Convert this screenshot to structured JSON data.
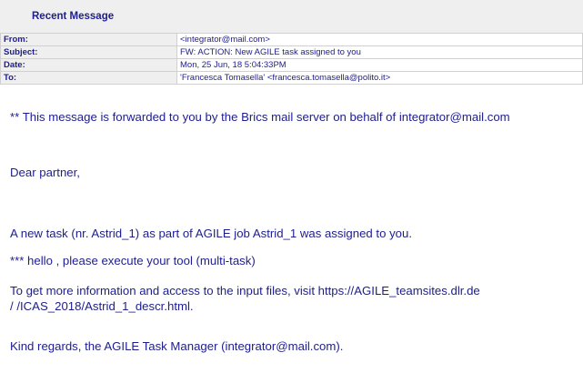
{
  "header": {
    "title": "Recent Message"
  },
  "meta": {
    "rows": [
      {
        "label": "From:",
        "value": "<integrator@mail.com>"
      },
      {
        "label": "Subject:",
        "value": "FW: ACTION: New AGILE task assigned to you"
      },
      {
        "label": "Date:",
        "value": "Mon, 25 Jun, 18 5:04:33PM"
      },
      {
        "label": "To:",
        "value": "'Francesca Tomasella' <francesca.tomasella@polito.it>"
      }
    ]
  },
  "body": {
    "forward_notice": "** This message is forwarded to you by the Brics mail server on behalf of integrator@mail.com",
    "greeting": "Dear partner,",
    "task_line": "A new task (nr. Astrid_1) as part of AGILE job Astrid_1 was assigned to you.",
    "instruction": "*** hello , please execute your tool (multi-task)",
    "info_line1": "To get more information and access to the input files, visit https://AGILE_teamsites.dlr.de",
    "info_line2": " / /ICAS_2018/Astrid_1_descr.html.",
    "closing": "Kind regards, the AGILE Task Manager (integrator@mail.com)."
  }
}
